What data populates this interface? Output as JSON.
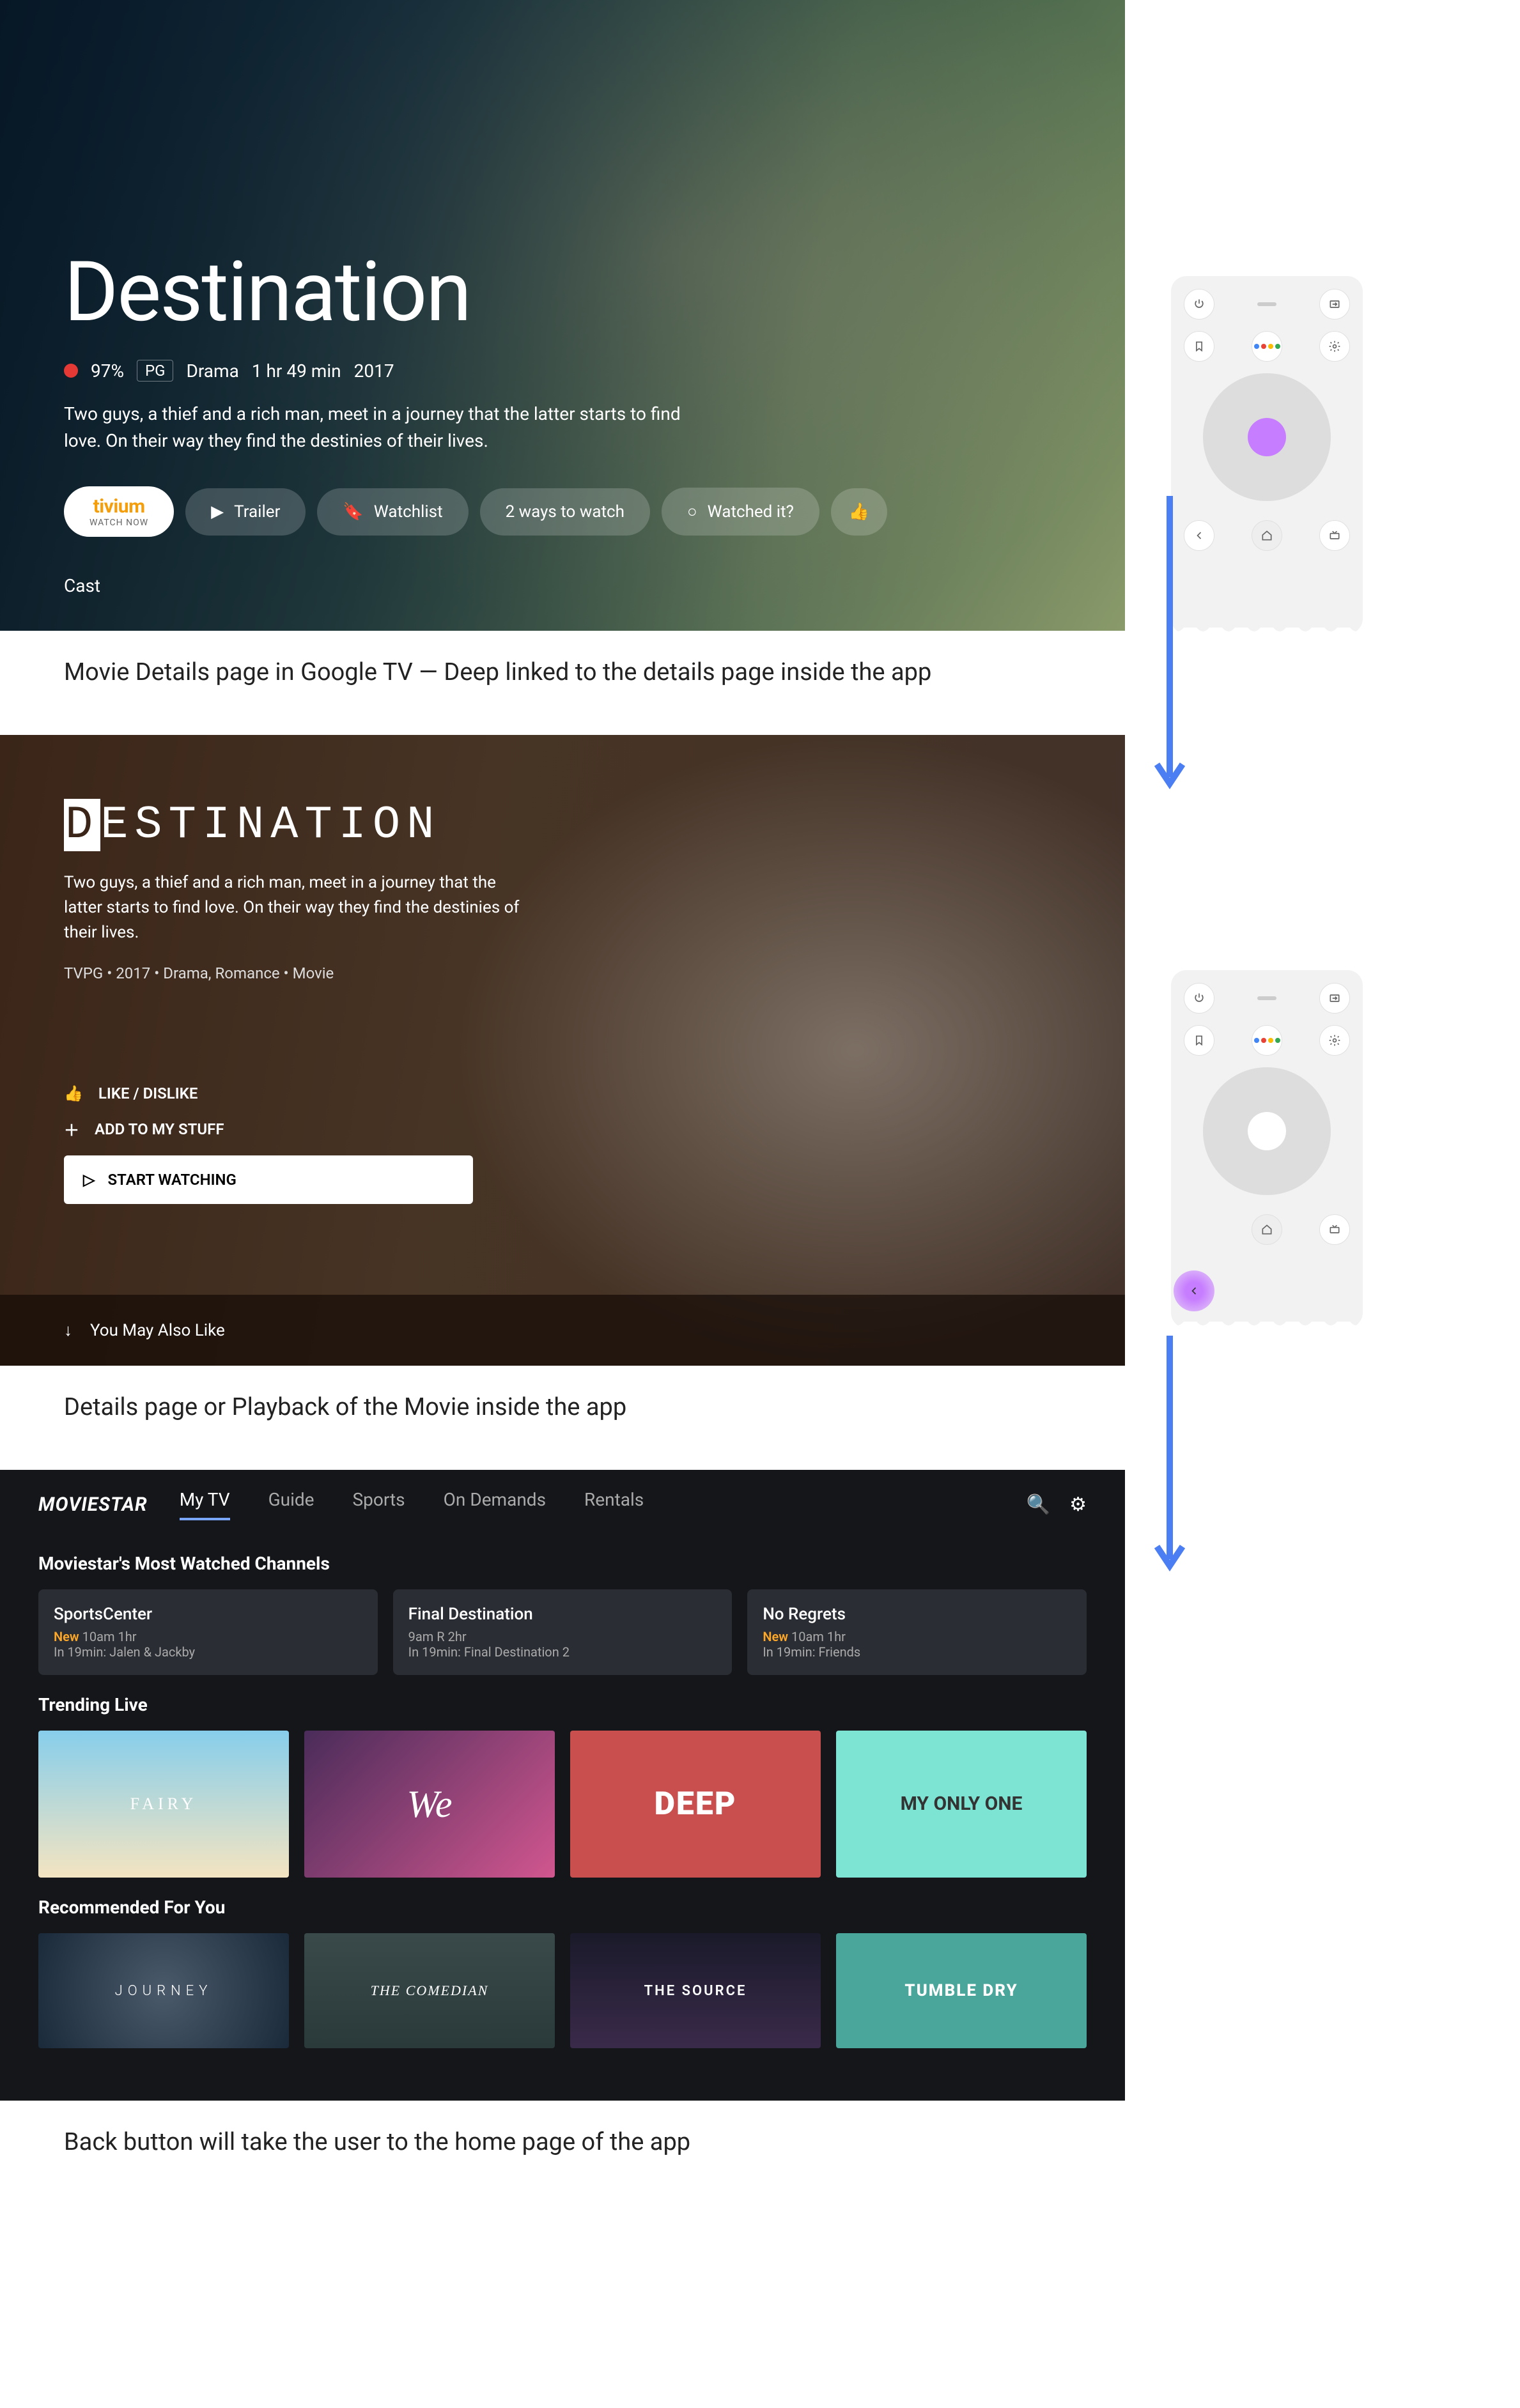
{
  "screen1": {
    "title": "Destination",
    "rating_pct": "97%",
    "pg": "PG",
    "genre": "Drama",
    "duration": "1 hr 49 min",
    "year": "2017",
    "description": "Two guys, a thief and a rich man, meet in a journey that the latter starts to find love. On their way they find the destinies of their lives.",
    "provider_brand": "tivium",
    "provider_sub": "WATCH NOW",
    "trailer": "Trailer",
    "watchlist": "Watchlist",
    "ways": "2 ways to watch",
    "watched": "Watched it?",
    "cast_label": "Cast"
  },
  "caption1": "Movie Details page in Google TV — Deep linked to the details page inside the app",
  "screen2": {
    "title_rest": "ESTINATION",
    "description": "Two guys, a thief and a rich man, meet in a journey that the latter starts to find love. On their way they find the destinies of their lives.",
    "meta": "TVPG • 2017 • Drama, Romance • Movie",
    "like": "LIKE / DISLIKE",
    "add": "ADD TO MY STUFF",
    "start": "START WATCHING",
    "ymal": "You May Also Like"
  },
  "caption2": "Details page or Playback of the Movie inside the app",
  "screen3": {
    "logo": "MOVIESTAR",
    "tabs": [
      "My TV",
      "Guide",
      "Sports",
      "On Demands",
      "Rentals"
    ],
    "section1": "Moviestar's Most Watched Channels",
    "cards": [
      {
        "title": "SportsCenter",
        "new": "New",
        "time": "10am 1hr",
        "next": "In 19min: Jalen & Jackby"
      },
      {
        "title": "Final Destination",
        "new": "",
        "time": "9am R 2hr",
        "next": "In 19min: Final Destination 2"
      },
      {
        "title": "No Regrets",
        "new": "New",
        "time": "10am 1hr",
        "next": "In 19min: Friends"
      }
    ],
    "section2": "Trending Live",
    "thumbs_trending": [
      "FAIRY",
      "We",
      "DEEP",
      "MY ONLY ONE"
    ],
    "section3": "Recommended For You",
    "thumbs_rec": [
      "JOURNEY",
      "THE COMEDIAN",
      "THE SOURCE",
      "TUMBLE DRY"
    ]
  },
  "caption3": "Back button will take the user to the home page of the app",
  "colors": {
    "arrow": "#4c7ef3",
    "touch_purple": "#c77dff",
    "touch_white": "#ffffff"
  }
}
